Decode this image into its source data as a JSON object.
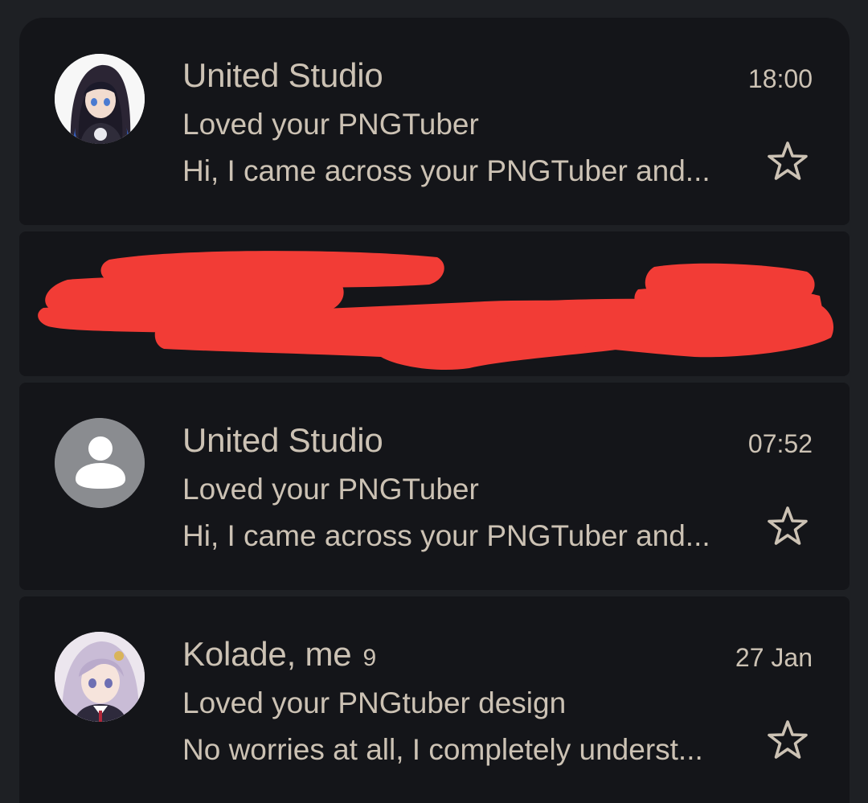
{
  "emails": [
    {
      "sender": "United Studio",
      "time": "18:00",
      "subject": "Loved your PNGTuber",
      "snippet": "Hi, I came across your PNGTuber and...",
      "avatar": "anime-hooded-girl-avatar",
      "starred": false
    },
    {
      "redacted": true,
      "redaction_color": "#f23c36"
    },
    {
      "sender": "United Studio",
      "time": "07:52",
      "subject": "Loved your PNGTuber",
      "snippet": "Hi, I came across your PNGTuber and...",
      "avatar": "default-person-avatar",
      "starred": false
    },
    {
      "sender": "Kolade, me",
      "count": "9",
      "time": "27 Jan",
      "subject": "Loved your PNGtuber design",
      "snippet": "No worries at all, I completely underst...",
      "avatar": "anime-lilac-hair-girl-avatar",
      "starred": false
    }
  ],
  "colors": {
    "background": "#1e2024",
    "card": "#141519",
    "text": "#ccc2b4",
    "default_avatar_bg": "#8a8c90"
  }
}
